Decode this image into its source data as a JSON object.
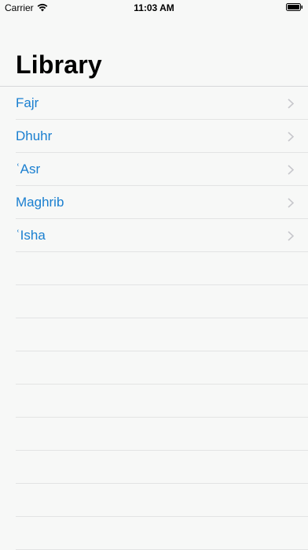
{
  "status_bar": {
    "carrier": "Carrier",
    "time": "11:03 AM"
  },
  "header": {
    "title": "Library"
  },
  "list": {
    "items": [
      {
        "label": "Fajr"
      },
      {
        "label": "Dhuhr"
      },
      {
        "label": "ʿAsr"
      },
      {
        "label": "Maghrib"
      },
      {
        "label": "ʿIsha"
      }
    ]
  },
  "colors": {
    "accent": "#1a7fd0",
    "background": "#f7f8f7",
    "separator": "#e3e4e4",
    "chevron": "#c7c7cc"
  },
  "icons": {
    "wifi": "wifi-icon",
    "battery": "battery-icon",
    "chevron": "chevron-right-icon"
  }
}
